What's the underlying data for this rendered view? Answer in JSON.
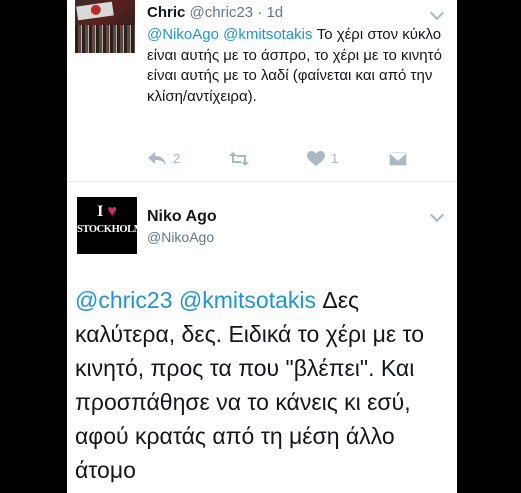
{
  "tweet1": {
    "name": "Chric",
    "handle": "@chric23",
    "time": "· 1d",
    "mention1": "@NikoAgo",
    "mention2": "@kmitsotakis",
    "text": " Το χέρι στον κύκλο είναι αυτής με το άσπρο, το χέρι με το κινητό είναι αυτής με το λαδί (φαίνεται και από την κλίση/αντίχειρα).",
    "reply_count": "2",
    "like_count": "1",
    "icons": [
      "reply-icon",
      "retweet-icon",
      "like-icon",
      "message-icon",
      "chevron-down-icon"
    ]
  },
  "tweet2": {
    "name": "Niko Ago",
    "handle": "@NikoAgo",
    "avatar_top": "I",
    "avatar_heart": "♥",
    "avatar_city": "STOCKHOLM",
    "mention1": "@chric23",
    "mention2": "@kmitsotakis",
    "text": " Δες καλύτερα, δες. Ειδικά το χέρι με το κινητό, προς τα που \"βλέπει\". Και προσπάθησε να το κάνεις κι εσύ, αφού κρατάς από τη μέση άλλο άτομο"
  },
  "colors": {
    "link": "#1b95e0",
    "muted": "#657786",
    "icon": "#aab8c2",
    "background": "#000000"
  }
}
